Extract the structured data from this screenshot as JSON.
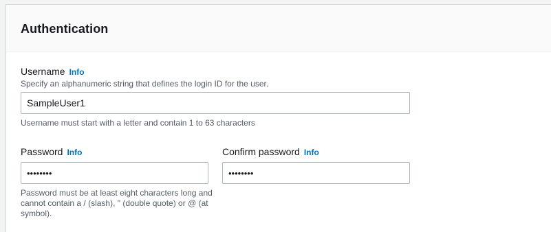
{
  "panel": {
    "title": "Authentication"
  },
  "username": {
    "label": "Username",
    "info_link": "Info",
    "description": "Specify an alphanumeric string that defines the login ID for the user.",
    "value": "SampleUser1",
    "constraint": "Username must start with a letter and contain 1 to 63 characters"
  },
  "password": {
    "label": "Password",
    "info_link": "Info",
    "value": "••••••••",
    "constraint": "Password must be at least eight characters long and cannot contain a / (slash), \" (double quote) or @ (at symbol)."
  },
  "confirm_password": {
    "label": "Confirm password",
    "info_link": "Info",
    "value": "••••••••"
  }
}
